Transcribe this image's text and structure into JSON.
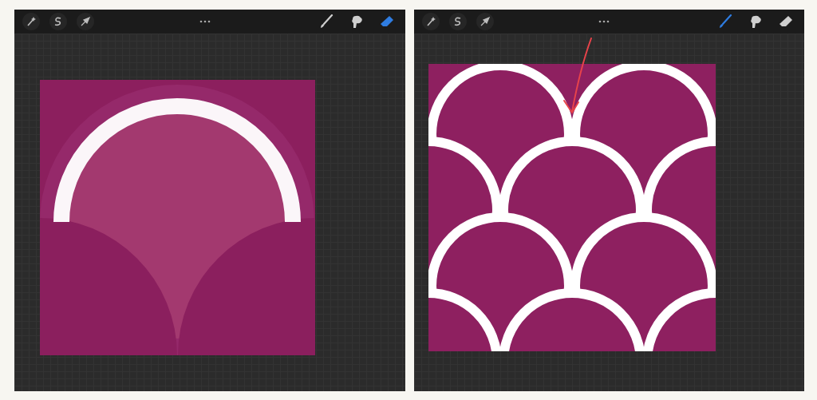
{
  "panels": [
    {
      "tools": [
        {
          "kind": "brush",
          "selected": false
        },
        {
          "kind": "smudge",
          "selected": false
        },
        {
          "kind": "eraser",
          "selected": true
        }
      ],
      "canvas": {
        "kind": "single-scale"
      }
    },
    {
      "tools": [
        {
          "kind": "brush",
          "selected": true
        },
        {
          "kind": "smudge",
          "selected": false
        },
        {
          "kind": "eraser",
          "selected": false
        }
      ],
      "canvas": {
        "kind": "tiled-scales",
        "annotation_arrow": true
      }
    }
  ]
}
